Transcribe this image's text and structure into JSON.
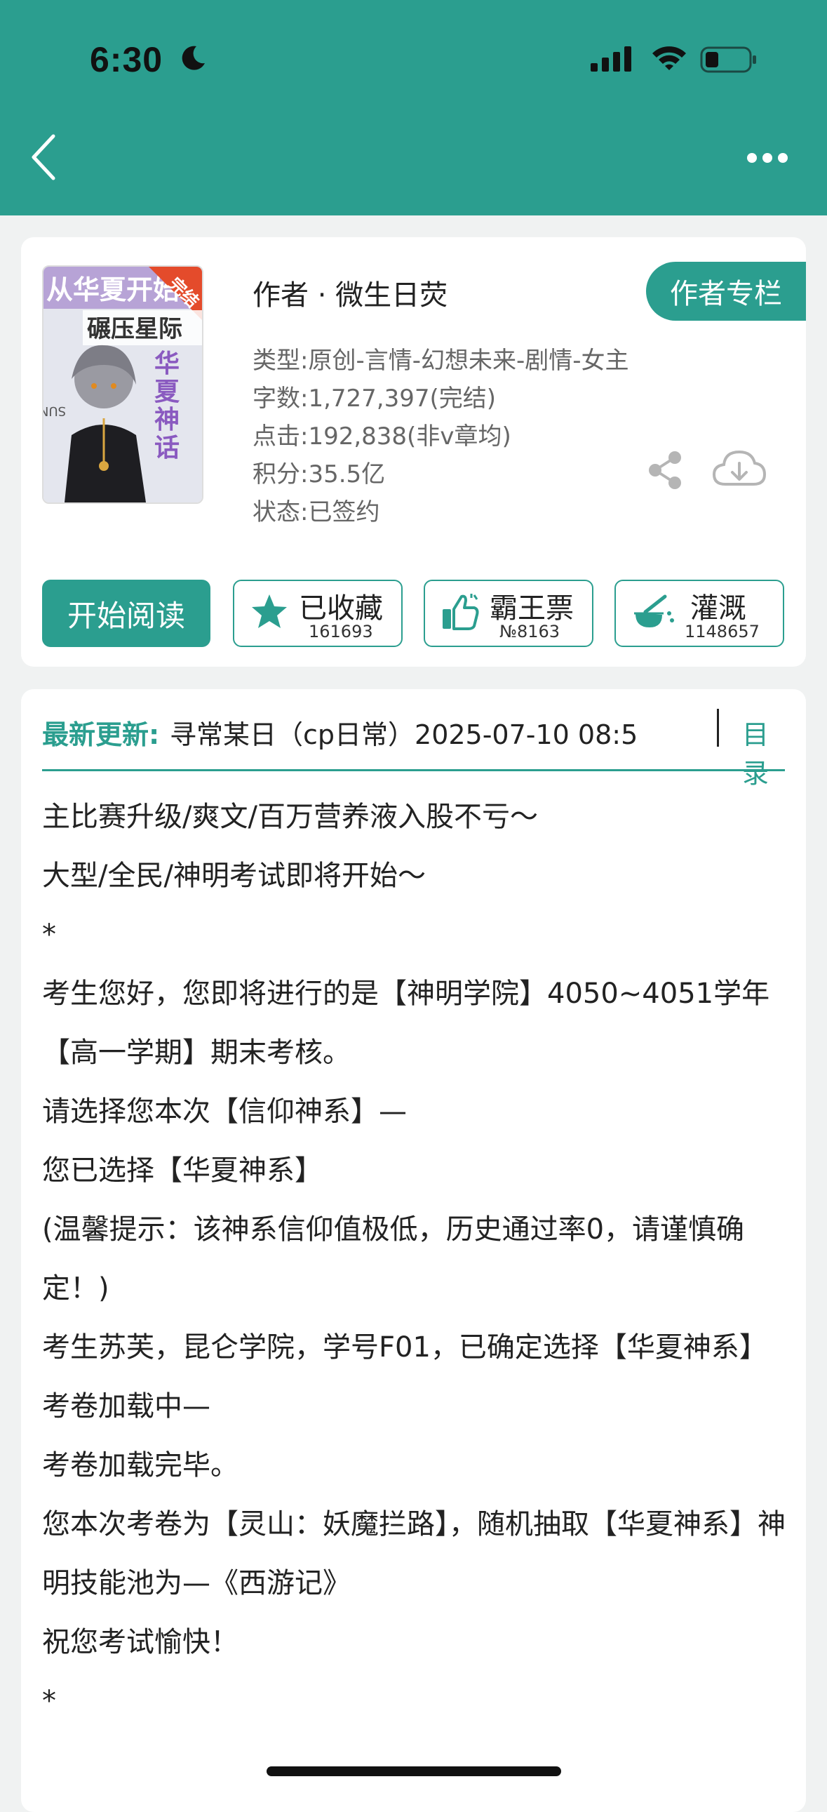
{
  "status_bar": {
    "time": "6:30"
  },
  "book": {
    "cover_title": "从华夏开始碾压星际",
    "cover_badge": "完结",
    "cover_subtitle": "华夏神话",
    "author_line": "作者 · 微生日荧",
    "author_column_btn": "作者专栏",
    "genre": "类型:原创-言情-幻想未来-剧情-女主",
    "words": "字数:1,727,397(完结)",
    "clicks": "点击:192,838(非v章均)",
    "score": "积分:35.5亿",
    "status": "状态:已签约"
  },
  "actions": {
    "start_reading": "开始阅读",
    "favorite": {
      "label": "已收藏",
      "count": "161693"
    },
    "bawang": {
      "label": "霸王票",
      "count": "№8163"
    },
    "irrigate": {
      "label": "灌溉",
      "count": "1148657"
    }
  },
  "update": {
    "label": "最新更新:",
    "text": "寻常某日（cp日常）2025-07-10 08:5",
    "toc": "目录"
  },
  "synopsis": [
    "主比赛升级/爽文/百万营养液入股不亏～",
    "大型/全民/神明考试即将开始～",
    "*",
    "考生您好，您即将进行的是【神明学院】4050~4051学年【高一学期】期末考核。",
    "请选择您本次【信仰神系】—",
    "您已选择【华夏神系】",
    "(温馨提示：该神系信仰值极低，历史通过率0，请谨慎确定！)",
    "考生苏芙，昆仑学院，学号F01，已确定选择【华夏神系】",
    "考卷加载中—",
    "考卷加载完毕。",
    "您本次考卷为【灵山：妖魔拦路】，随机抽取【华夏神系】神明技能池为—《西游记》",
    "祝您考试愉快！",
    "*"
  ],
  "colors": {
    "accent": "#2b9e8f",
    "page_bg": "#f0f2f2"
  }
}
